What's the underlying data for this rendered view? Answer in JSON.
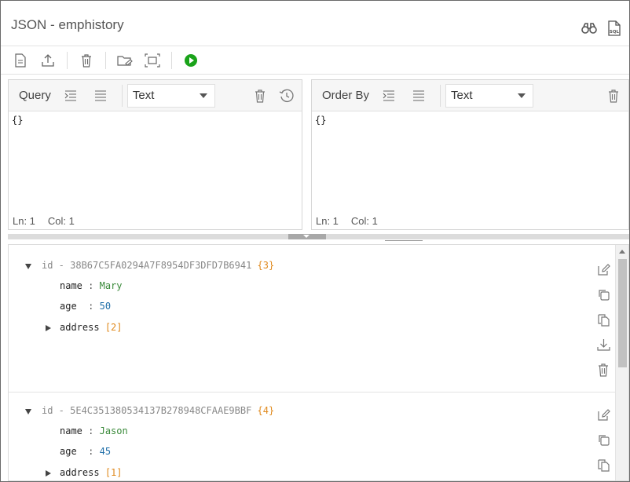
{
  "window": {
    "title": "JSON - emphistory"
  },
  "title_icons": [
    "binoculars-icon",
    "sql-file-icon"
  ],
  "toolbar": {
    "items": [
      "new-document-icon",
      "upload-icon",
      "delete-icon",
      "open-folder-icon",
      "select-area-icon",
      "run-icon"
    ],
    "run_color": "#1aa31a"
  },
  "query_editor": {
    "label": "Query",
    "format": "Text",
    "content": "{}",
    "status": {
      "line": "Ln: 1",
      "col": "Col: 1"
    }
  },
  "order_editor": {
    "label": "Order By",
    "format": "Text",
    "content": "{}",
    "status": {
      "line": "Ln: 1",
      "col": "Col: 1"
    }
  },
  "documents": [
    {
      "id_text": "id - 38B67C5FA0294A7F8954DF3DFD7B6941",
      "count": "{3}",
      "fields": [
        {
          "key": "name",
          "colon": ":",
          "value": "Mary"
        },
        {
          "key": "age",
          "colon": ":",
          "value": "50"
        }
      ],
      "nested": {
        "key": "address",
        "count": "[2]"
      }
    },
    {
      "id_text": "id - 5E4C351380534137B278948CFAAE9BBF",
      "count": "{4}",
      "fields": [
        {
          "key": "name",
          "colon": ":",
          "value": "Jason"
        },
        {
          "key": "age",
          "colon": ":",
          "value": "45"
        }
      ],
      "nested": {
        "key": "address",
        "count": "[1]"
      }
    }
  ],
  "colors": {
    "string": "#3a8a3a",
    "number": "#1f6ea8",
    "brace": "#e08a1e",
    "id": "#888888"
  }
}
